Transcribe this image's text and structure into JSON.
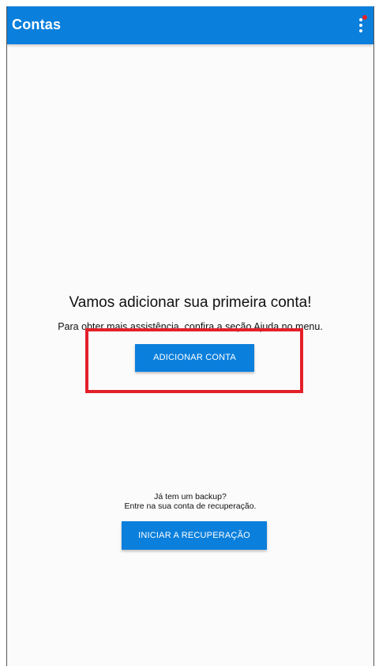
{
  "appbar": {
    "title": "Contas",
    "menu_icon": "more-vert-icon",
    "notification_dot_color": "#e3202a"
  },
  "empty_state": {
    "title": "Vamos adicionar sua primeira conta!",
    "subtitle": "Para obter mais assistência, confira a seção Ajuda no menu.",
    "add_button_label": "ADICIONAR CONTA"
  },
  "recovery": {
    "question": "Já tem um backup?",
    "instruction": "Entre na sua conta de recuperação.",
    "button_label": "INICIAR A RECUPERAÇÃO"
  },
  "colors": {
    "accent": "#0a7fdc",
    "highlight": "#e3202a",
    "background": "#fbfbfb"
  }
}
